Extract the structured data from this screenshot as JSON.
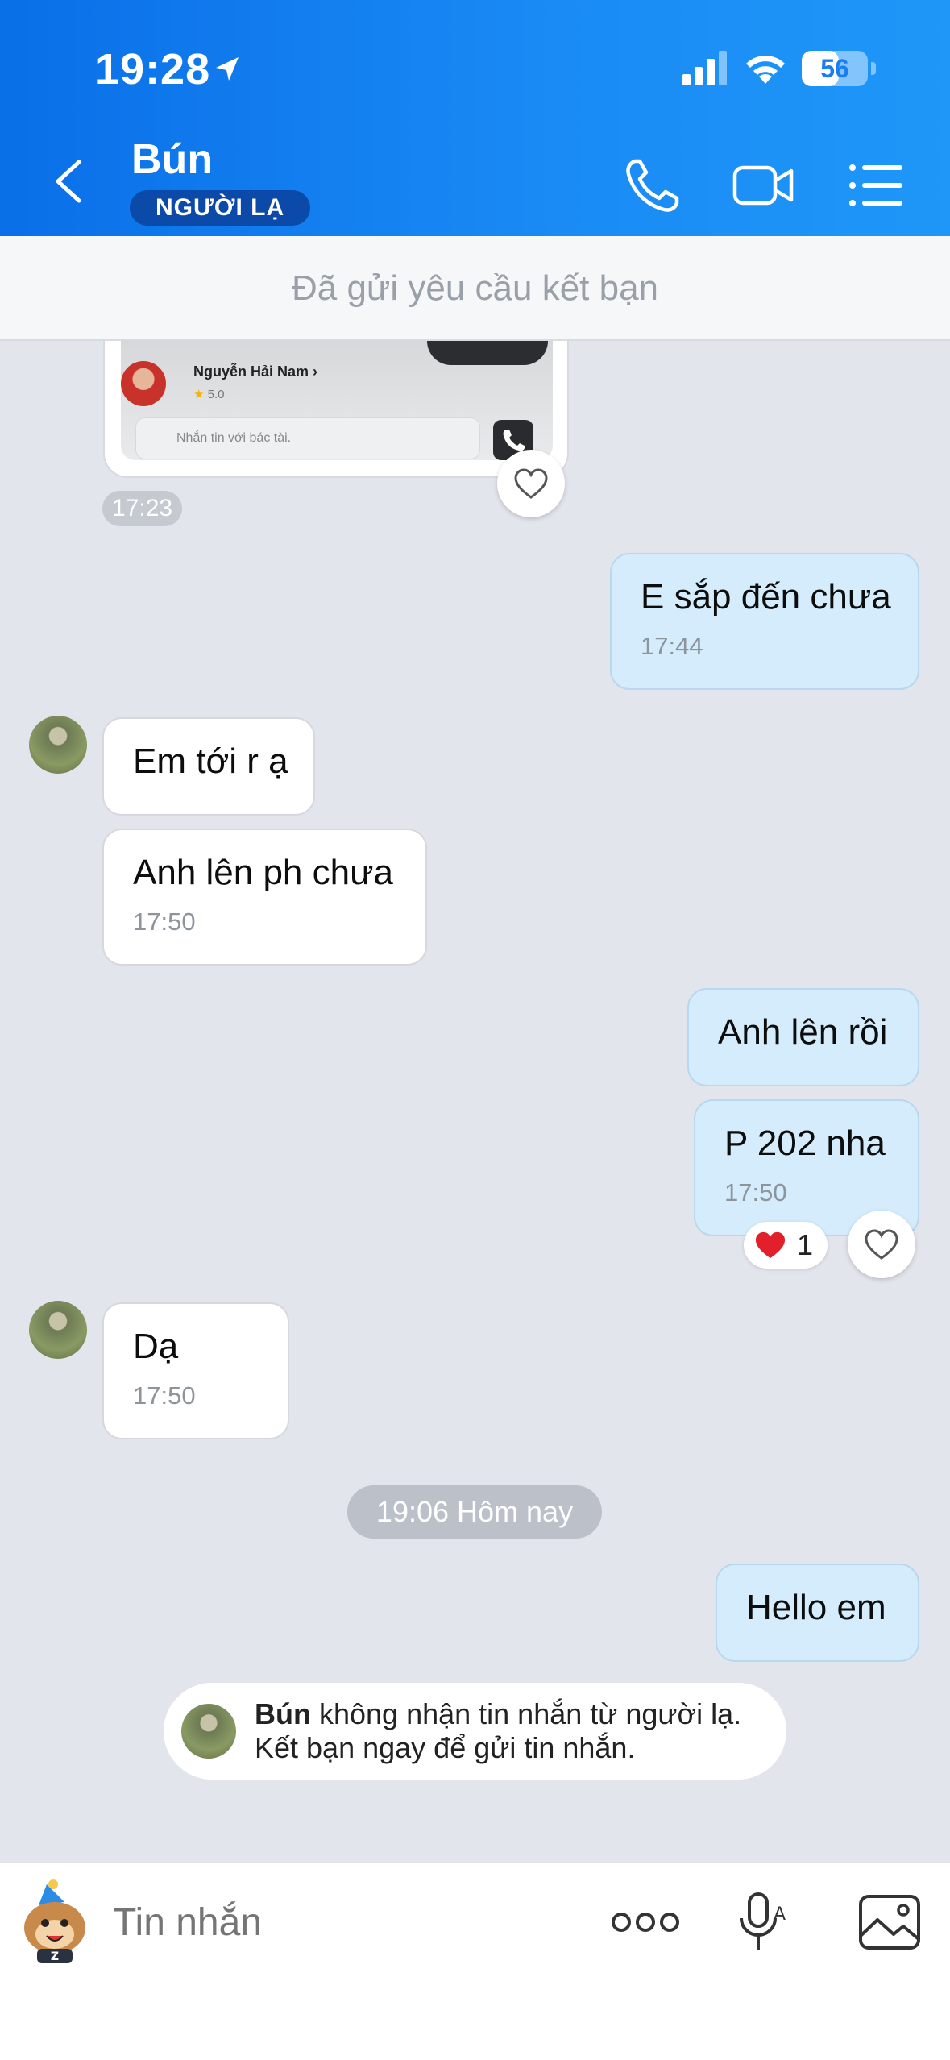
{
  "status_bar": {
    "time": "19:28",
    "battery": "56",
    "battery_level": 0.56
  },
  "header": {
    "contact_name": "Bún",
    "badge": "NGƯỜI LẠ"
  },
  "request_bar": {
    "text": "Đã gửi yêu cầu kết bạn"
  },
  "shared_card": {
    "driver_name": "Nguyễn Hải Nam",
    "rating": "5.0",
    "input_placeholder": "Nhắn tin với bác tài.",
    "time": "17:23"
  },
  "messages": [
    {
      "text": "E sắp đến chưa",
      "time": "17:44",
      "direction": "out"
    },
    {
      "text": "Em tới r ạ",
      "direction": "in"
    },
    {
      "text": "Anh lên ph chưa",
      "time": "17:50",
      "direction": "in"
    },
    {
      "text": "Anh lên rồi",
      "direction": "out"
    },
    {
      "text": "P 202 nha",
      "time": "17:50",
      "direction": "out",
      "reaction": "1"
    },
    {
      "text": "Dạ",
      "time": "17:50",
      "direction": "in"
    },
    {
      "text": "Hello em",
      "direction": "out"
    }
  ],
  "date_divider": "19:06 Hôm nay",
  "notice": {
    "name": "Bún",
    "line1": " không nhận tin nhắn từ người lạ.",
    "line2": "Kết bạn ngay để gửi tin nhắn."
  },
  "composer": {
    "placeholder": "Tin nhắn"
  },
  "colors": {
    "header": "#0a6fe8",
    "bubble_out": "#d4ecfb",
    "bubble_in": "#ffffff",
    "background": "#e2e5ec"
  }
}
